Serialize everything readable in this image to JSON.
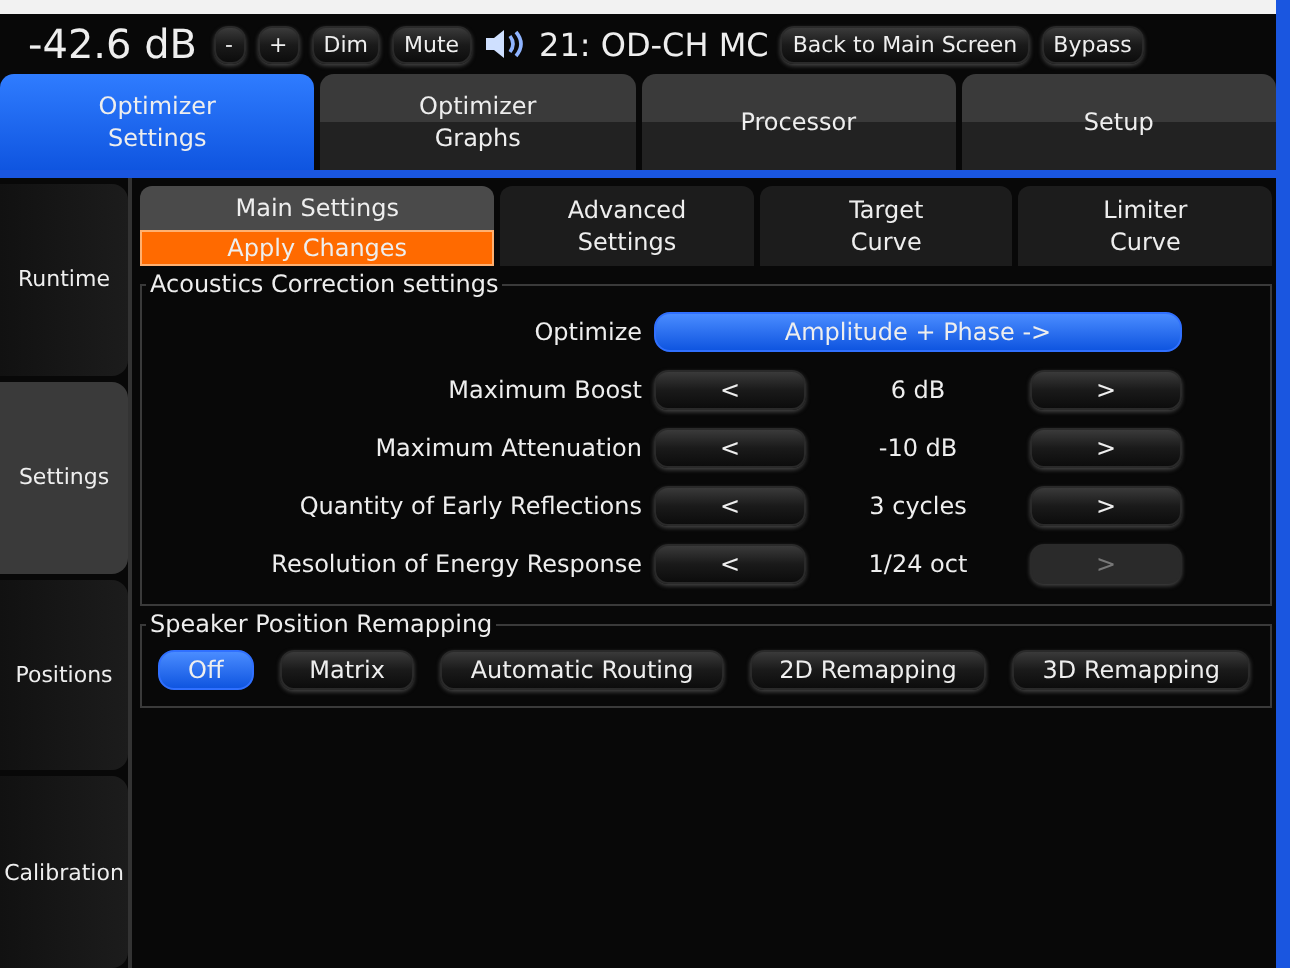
{
  "header": {
    "level": "-42.6 dB",
    "buttons": [
      {
        "label": "-"
      },
      {
        "label": "+"
      },
      {
        "label": "Dim"
      },
      {
        "label": "Mute"
      }
    ],
    "preset": "21: OD-CH MC",
    "actions": [
      {
        "label": "Back to Main Screen"
      },
      {
        "label": "Bypass"
      }
    ]
  },
  "tabs": [
    {
      "label": "Optimizer\nSettings",
      "selected": true
    },
    {
      "label": "Optimizer\nGraphs",
      "selected": false
    },
    {
      "label": "Processor",
      "selected": false
    },
    {
      "label": "Setup",
      "selected": false
    }
  ],
  "sidebar": [
    {
      "label": "Runtime",
      "selected": false
    },
    {
      "label": "Settings",
      "selected": true
    },
    {
      "label": "Positions",
      "selected": false
    },
    {
      "label": "Calibration",
      "selected": false
    }
  ],
  "subtabs": [
    {
      "label": "Main Settings",
      "selected": true,
      "action": "Apply Changes"
    },
    {
      "label": "Advanced\nSettings",
      "selected": false
    },
    {
      "label": "Target\nCurve",
      "selected": false
    },
    {
      "label": "Limiter\nCurve",
      "selected": false
    }
  ],
  "acoustics": {
    "title": "Acoustics Correction settings",
    "rows": [
      {
        "kind": "select",
        "label": "Optimize",
        "value": "Amplitude + Phase ->"
      },
      {
        "kind": "stepper",
        "label": "Maximum Boost",
        "prev": "<",
        "value": "6 dB",
        "next": ">",
        "next_disabled": false
      },
      {
        "kind": "stepper",
        "label": "Maximum Attenuation",
        "prev": "<",
        "value": "-10 dB",
        "next": ">",
        "next_disabled": false
      },
      {
        "kind": "stepper",
        "label": "Quantity of Early Reflections",
        "prev": "<",
        "value": "3 cycles",
        "next": ">",
        "next_disabled": false
      },
      {
        "kind": "stepper",
        "label": "Resolution of Energy Response",
        "prev": "<",
        "value": "1/24 oct",
        "next": ">",
        "next_disabled": true
      }
    ]
  },
  "remapping": {
    "title": "Speaker Position Remapping",
    "options": [
      {
        "label": "Off",
        "selected": true
      },
      {
        "label": "Matrix",
        "selected": false
      },
      {
        "label": "Automatic Routing",
        "selected": false
      },
      {
        "label": "2D Remapping",
        "selected": false
      },
      {
        "label": "3D Remapping",
        "selected": false
      }
    ]
  }
}
